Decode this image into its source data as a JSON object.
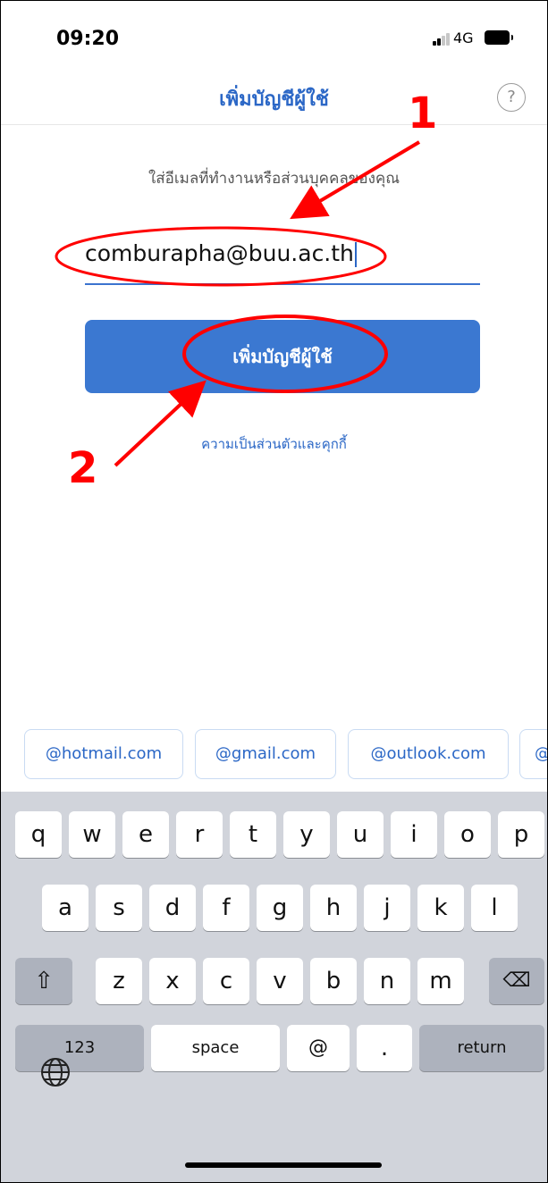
{
  "status": {
    "time": "09:20",
    "network": "4G"
  },
  "nav": {
    "title": "เพิ่มบัญชีผู้ใช้",
    "help": "?"
  },
  "form": {
    "subtitle": "ใส่อีเมลที่ทำงานหรือส่วนบุคคลของคุณ",
    "email_value": "comburapha@buu.ac.th",
    "button_label": "เพิ่มบัญชีผู้ใช้",
    "privacy_link": "ความเป็นส่วนตัวและคุกกี้"
  },
  "suggestions": [
    "@hotmail.com",
    "@gmail.com",
    "@outlook.com",
    "@"
  ],
  "keyboard": {
    "row1": [
      "q",
      "w",
      "e",
      "r",
      "t",
      "y",
      "u",
      "i",
      "o",
      "p"
    ],
    "row2": [
      "a",
      "s",
      "d",
      "f",
      "g",
      "h",
      "j",
      "k",
      "l"
    ],
    "row3": [
      "z",
      "x",
      "c",
      "v",
      "b",
      "n",
      "m"
    ],
    "shift": "⇧",
    "backspace": "⌫",
    "numbers": "123",
    "space": "space",
    "at": "@",
    "dot": ".",
    "return": "return"
  },
  "annotations": {
    "step1": "1",
    "step2": "2"
  },
  "colors": {
    "accent": "#3b78d1",
    "annotation": "#ff0000"
  }
}
